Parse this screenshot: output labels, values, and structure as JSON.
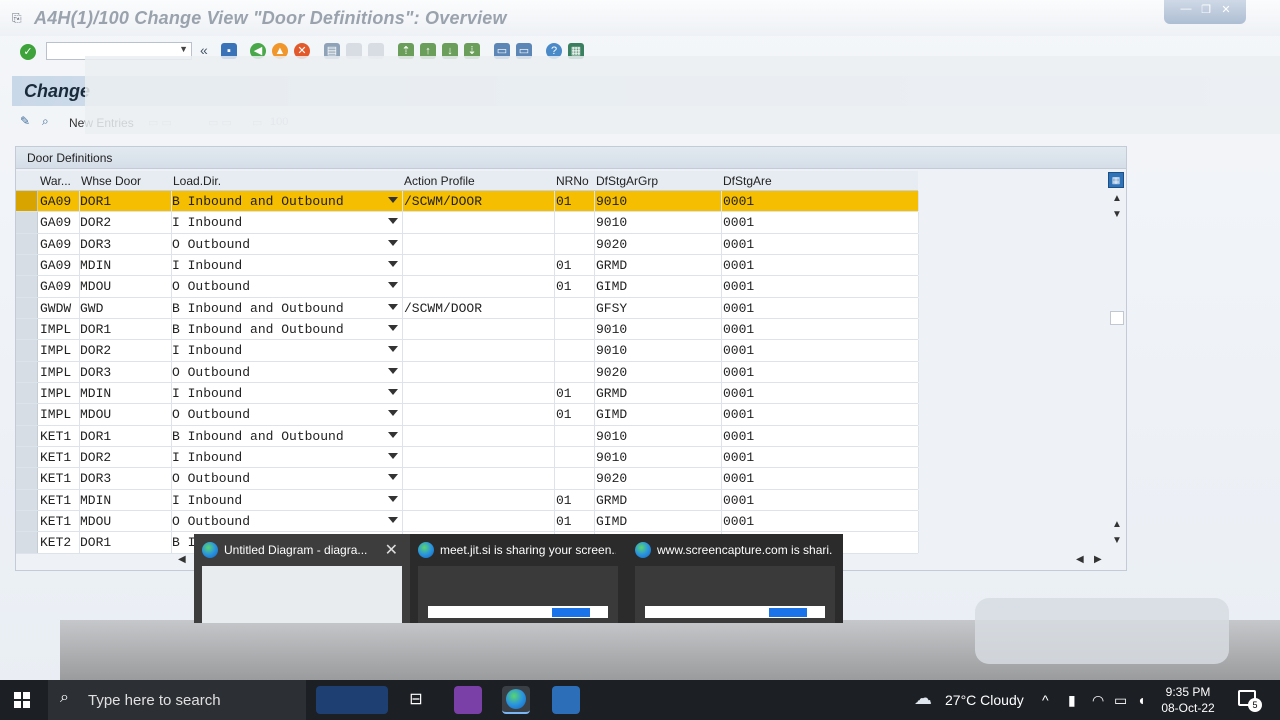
{
  "window": {
    "title": "A4H(1)/100 Change View \"Door Definitions\": Overview",
    "page_title": "Change",
    "controls": [
      "—",
      "❐",
      "✕"
    ]
  },
  "toolbar": {
    "command_value": "",
    "back_glyph": "«"
  },
  "app_toolbar": {
    "new_entries": "New Entries",
    "faded_page": "100"
  },
  "panel": {
    "title": "Door Definitions",
    "columns": [
      "War...",
      "Whse Door",
      "Load.Dir.",
      "Action Profile",
      "NRNo",
      "DfStgArGrp",
      "DfStgAre"
    ],
    "rows": [
      {
        "warehouse": "GA09",
        "door": "DOR1",
        "loaddir": "B Inbound and Outbound",
        "profile": "/SCWM/DOOR",
        "nrno": "01",
        "grp": "9010",
        "area": "0001",
        "selected": true
      },
      {
        "warehouse": "GA09",
        "door": "DOR2",
        "loaddir": "I Inbound",
        "profile": "",
        "nrno": "",
        "grp": "9010",
        "area": "0001"
      },
      {
        "warehouse": "GA09",
        "door": "DOR3",
        "loaddir": "O Outbound",
        "profile": "",
        "nrno": "",
        "grp": "9020",
        "area": "0001"
      },
      {
        "warehouse": "GA09",
        "door": "MDIN",
        "loaddir": "I Inbound",
        "profile": "",
        "nrno": "01",
        "grp": "GRMD",
        "area": "0001"
      },
      {
        "warehouse": "GA09",
        "door": "MDOU",
        "loaddir": "O Outbound",
        "profile": "",
        "nrno": "01",
        "grp": "GIMD",
        "area": "0001"
      },
      {
        "warehouse": "GWDW",
        "door": "GWD",
        "loaddir": "B Inbound and Outbound",
        "profile": "/SCWM/DOOR",
        "nrno": "",
        "grp": "GFSY",
        "area": "0001"
      },
      {
        "warehouse": "IMPL",
        "door": "DOR1",
        "loaddir": "B Inbound and Outbound",
        "profile": "",
        "nrno": "",
        "grp": "9010",
        "area": "0001"
      },
      {
        "warehouse": "IMPL",
        "door": "DOR2",
        "loaddir": "I Inbound",
        "profile": "",
        "nrno": "",
        "grp": "9010",
        "area": "0001"
      },
      {
        "warehouse": "IMPL",
        "door": "DOR3",
        "loaddir": "O Outbound",
        "profile": "",
        "nrno": "",
        "grp": "9020",
        "area": "0001"
      },
      {
        "warehouse": "IMPL",
        "door": "MDIN",
        "loaddir": "I Inbound",
        "profile": "",
        "nrno": "01",
        "grp": "GRMD",
        "area": "0001"
      },
      {
        "warehouse": "IMPL",
        "door": "MDOU",
        "loaddir": "O Outbound",
        "profile": "",
        "nrno": "01",
        "grp": "GIMD",
        "area": "0001"
      },
      {
        "warehouse": "KET1",
        "door": "DOR1",
        "loaddir": "B Inbound and Outbound",
        "profile": "",
        "nrno": "",
        "grp": "9010",
        "area": "0001"
      },
      {
        "warehouse": "KET1",
        "door": "DOR2",
        "loaddir": "I Inbound",
        "profile": "",
        "nrno": "",
        "grp": "9010",
        "area": "0001"
      },
      {
        "warehouse": "KET1",
        "door": "DOR3",
        "loaddir": "O Outbound",
        "profile": "",
        "nrno": "",
        "grp": "9020",
        "area": "0001"
      },
      {
        "warehouse": "KET1",
        "door": "MDIN",
        "loaddir": "I Inbound",
        "profile": "",
        "nrno": "01",
        "grp": "GRMD",
        "area": "0001"
      },
      {
        "warehouse": "KET1",
        "door": "MDOU",
        "loaddir": "O Outbound",
        "profile": "",
        "nrno": "01",
        "grp": "GIMD",
        "area": "0001"
      },
      {
        "warehouse": "KET2",
        "door": "DOR1",
        "loaddir": "B I",
        "profile": "",
        "nrno": "",
        "grp": "",
        "area": ""
      }
    ]
  },
  "thumbnails": [
    {
      "title": "Untitled Diagram - diagra...",
      "active": true
    },
    {
      "title": "meet.jit.si is sharing your screen...",
      "active": false
    },
    {
      "title": "www.screencapture.com is shari...",
      "active": false
    }
  ],
  "taskbar": {
    "search_placeholder": "Type here to search",
    "weather": "27°C  Cloudy",
    "time": "9:35 PM",
    "date": "08-Oct-22",
    "notifications": "5"
  },
  "colors": {
    "selected_row": "#f6be00",
    "taskbar": "#1c1f24"
  }
}
